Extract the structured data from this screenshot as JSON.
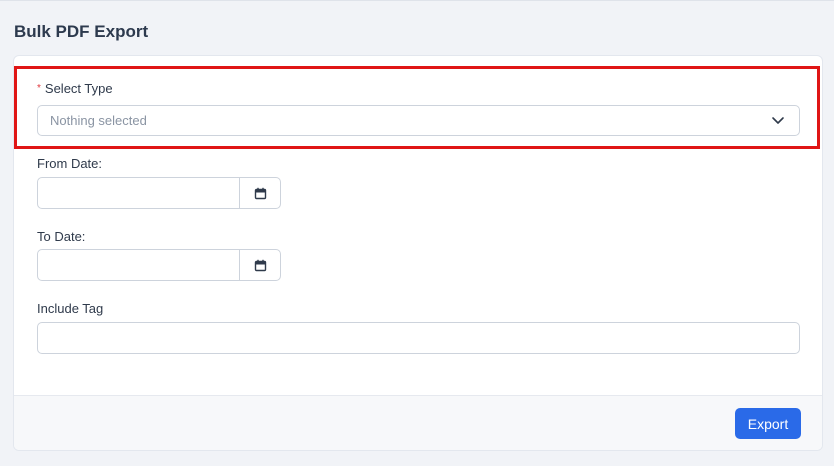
{
  "page": {
    "title": "Bulk PDF Export"
  },
  "form": {
    "select_type": {
      "label": "Select Type",
      "required_mark": "*",
      "placeholder": "Nothing selected"
    },
    "from_date": {
      "label": "From Date:",
      "value": ""
    },
    "to_date": {
      "label": "To Date:",
      "value": ""
    },
    "include_tag": {
      "label": "Include Tag",
      "value": ""
    }
  },
  "footer": {
    "export_label": "Export"
  },
  "icons": {
    "chevron": "chevron-down-icon",
    "calendar": "calendar-icon"
  },
  "colors": {
    "primary": "#2a6ae8",
    "highlight": "#e01515",
    "required": "#e0383e"
  }
}
